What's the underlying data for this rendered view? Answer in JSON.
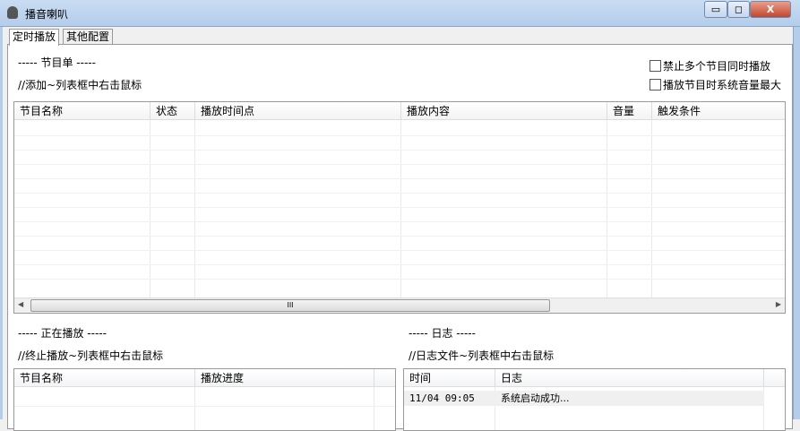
{
  "window": {
    "title": "播音喇叭",
    "minimize": "▭",
    "maximize": "◻",
    "close": "X"
  },
  "tabs": [
    {
      "label": "定时播放"
    },
    {
      "label": "其他配置"
    }
  ],
  "program": {
    "heading": "----- 节目单 -----",
    "hint": "//添加~列表框中右击鼠标",
    "columns": [
      "节目名称",
      "状态",
      "播放时间点",
      "播放内容",
      "音量",
      "触发条件"
    ],
    "scroll_thumb": "III"
  },
  "options": [
    {
      "label": "禁止多个节目同时播放",
      "checked": false
    },
    {
      "label": "播放节目时系统音量最大",
      "checked": false
    }
  ],
  "playing": {
    "heading": "----- 正在播放 -----",
    "hint": "//终止播放~列表框中右击鼠标",
    "columns": [
      "节目名称",
      "播放进度"
    ]
  },
  "log": {
    "heading": "----- 日志 -----",
    "hint": "//日志文件~列表框中右击鼠标",
    "columns": [
      "时间",
      "日志"
    ],
    "rows": [
      {
        "time": "11/04 09:05",
        "message": "系统启动成功..."
      }
    ]
  }
}
